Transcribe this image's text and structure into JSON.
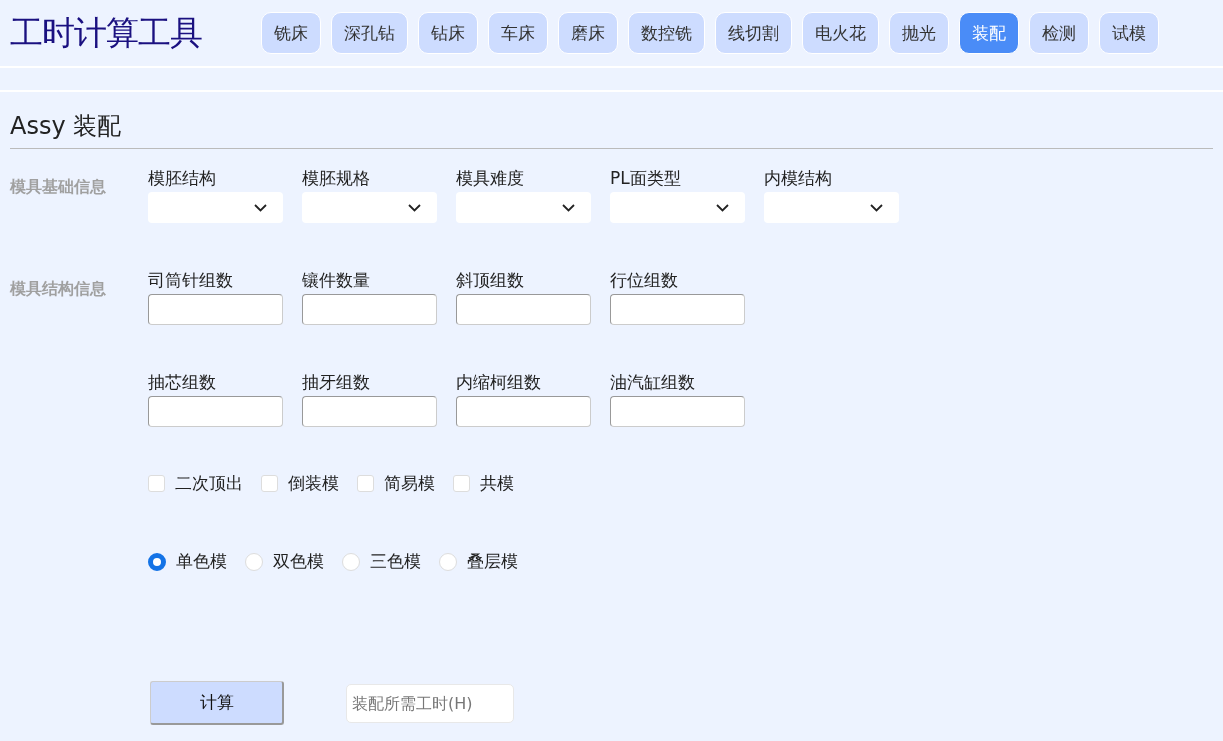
{
  "app_title": "工时计算工具",
  "tabs": [
    {
      "label": "铣床",
      "selected": false
    },
    {
      "label": "深孔钻",
      "selected": false
    },
    {
      "label": "钻床",
      "selected": false
    },
    {
      "label": "车床",
      "selected": false
    },
    {
      "label": "磨床",
      "selected": false
    },
    {
      "label": "数控铣",
      "selected": false
    },
    {
      "label": "线切割",
      "selected": false
    },
    {
      "label": "电火花",
      "selected": false
    },
    {
      "label": "抛光",
      "selected": false
    },
    {
      "label": "装配",
      "selected": true
    },
    {
      "label": "检测",
      "selected": false
    },
    {
      "label": "试模",
      "selected": false
    }
  ],
  "section_title": "Assy 装配",
  "groups": [
    {
      "heading": "模具基础信息",
      "rows": [
        [
          {
            "label": "模胚结构",
            "kind": "select"
          },
          {
            "label": "模胚规格",
            "kind": "select"
          },
          {
            "label": "模具难度",
            "kind": "select"
          },
          {
            "label": "PL面类型",
            "kind": "select"
          },
          {
            "label": "内模结构",
            "kind": "select"
          }
        ]
      ]
    },
    {
      "heading": "模具结构信息",
      "rows": [
        [
          {
            "label": "司筒针组数",
            "kind": "input"
          },
          {
            "label": "镶件数量",
            "kind": "input"
          },
          {
            "label": "斜顶组数",
            "kind": "input"
          },
          {
            "label": "行位组数",
            "kind": "input"
          }
        ],
        [
          {
            "label": "抽芯组数",
            "kind": "input"
          },
          {
            "label": "抽牙组数",
            "kind": "input"
          },
          {
            "label": "内缩柯组数",
            "kind": "input"
          },
          {
            "label": "油汽缸组数",
            "kind": "input"
          }
        ]
      ]
    }
  ],
  "options": [
    {
      "label": "二次顶出",
      "checked": false
    },
    {
      "label": "倒装模",
      "checked": false
    },
    {
      "label": "简易模",
      "checked": false
    },
    {
      "label": "共模",
      "checked": false
    }
  ],
  "mold_colors": [
    {
      "label": "单色模",
      "selected": true
    },
    {
      "label": "双色模",
      "selected": false
    },
    {
      "label": "三色模",
      "selected": false
    },
    {
      "label": "叠层模",
      "selected": false
    }
  ],
  "calculate_button": "计算",
  "result_field": {
    "placeholder": "装配所需工时(H)"
  }
}
